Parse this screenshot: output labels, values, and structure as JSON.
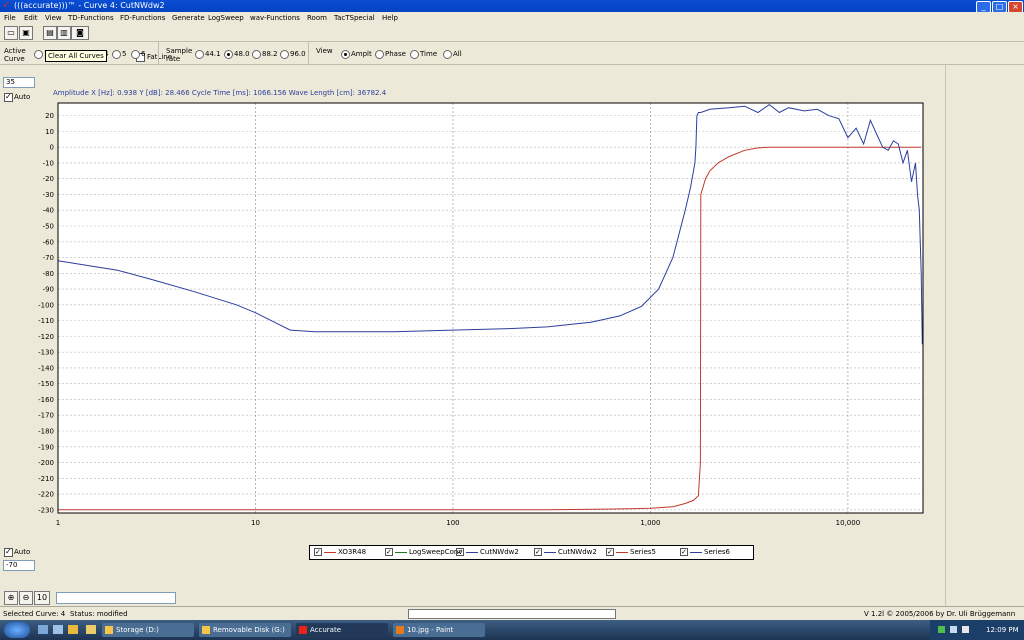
{
  "window": {
    "title": "(((accurate)))™ - Curve 4: CutNWdw2"
  },
  "menu": [
    "File",
    "Edit",
    "View",
    "TD-Functions",
    "FD-Functions",
    "Generate",
    "LogSweep",
    "wav-Functions",
    "Room",
    "TacTSpecial",
    "Help"
  ],
  "toolbar": {
    "fatline_label": "FatLine",
    "fatline_checked": false
  },
  "tooltip": {
    "text": "Clear All Curves"
  },
  "active_curve": {
    "label_line1": "Active",
    "label_line2": "Curve",
    "options": [
      "1",
      "4",
      "5",
      "6"
    ]
  },
  "sample_rate": {
    "label_line1": "Sample",
    "label_line2": "rate",
    "options": [
      "44.1",
      "48.0",
      "88.2",
      "96.0"
    ],
    "selected": "48.0"
  },
  "view": {
    "label": "View",
    "options": [
      "Amplt",
      "Phase",
      "Time",
      "All"
    ],
    "selected": "Amplt"
  },
  "y_axis": {
    "top_value": "35",
    "bottom_value": "-70",
    "auto_label": "Auto",
    "auto_checked": true
  },
  "info_line": "Amplitude   X [Hz]: 0.938   Y [dB]: 28.466   Cycle Time [ms]: 1066.156   Wave Length [cm]: 36782.4",
  "chart_data": {
    "type": "line",
    "xscale": "log",
    "xlim": [
      1,
      24000
    ],
    "ylim": [
      -232,
      28
    ],
    "y_ticks": [
      20,
      10,
      0,
      -10,
      -20,
      -30,
      -40,
      -50,
      -60,
      -70,
      -80,
      -90,
      -100,
      -110,
      -120,
      -130,
      -140,
      -150,
      -160,
      -170,
      -180,
      -190,
      -200,
      -210,
      -220,
      -230
    ],
    "x_tick_labels": [
      {
        "value": 1,
        "label": "1"
      },
      {
        "value": 10,
        "label": "10"
      },
      {
        "value": 100,
        "label": "100"
      },
      {
        "value": 1000,
        "label": "1,000"
      },
      {
        "value": 10000,
        "label": "10,000"
      }
    ],
    "grid": true,
    "series": [
      {
        "name": "XO3R48",
        "color": "#c0392b",
        "x": [
          1,
          100,
          300,
          600,
          1000,
          1300,
          1500,
          1650,
          1750,
          1790,
          1800,
          1850,
          1900,
          2000,
          2200,
          2500,
          3000,
          3500,
          4000,
          6000,
          10000,
          15000,
          20000,
          22000,
          23500
        ],
        "y": [
          -230,
          -230,
          -230,
          -229.5,
          -229,
          -228,
          -226,
          -224,
          -221,
          -200,
          -30,
          -25,
          -20,
          -15,
          -10,
          -6,
          -2,
          -0.5,
          0,
          0,
          0,
          0,
          0,
          0,
          0
        ]
      },
      {
        "name": "CutNWdw2",
        "color": "#2c3e9e",
        "x": [
          1,
          2,
          3,
          5,
          8,
          10,
          12,
          15,
          20,
          30,
          50,
          100,
          200,
          300,
          500,
          700,
          900,
          1100,
          1300,
          1500,
          1600,
          1680,
          1700,
          1720,
          1750,
          1800,
          2000,
          2500,
          3000,
          3500,
          4000,
          4500,
          5000,
          6000,
          7000,
          8000,
          9000,
          10000,
          11000,
          12000,
          13000,
          14000,
          15000,
          16000,
          17000,
          18000,
          19000,
          20000,
          21000,
          22000,
          22500,
          23000,
          23500,
          23800
        ],
        "y": [
          -72,
          -78,
          -84,
          -92,
          -100,
          -105,
          -110,
          -116,
          -117,
          -117,
          -117,
          -116,
          -115,
          -114,
          -111,
          -107,
          -101,
          -90,
          -70,
          -40,
          -25,
          -10,
          0,
          20,
          22,
          22,
          24,
          25,
          26,
          22,
          27,
          22,
          25,
          23,
          24,
          20,
          18,
          6,
          12,
          2,
          17,
          8,
          0,
          -2,
          4,
          2,
          -10,
          -2,
          -22,
          -10,
          -30,
          -40,
          -80,
          -125
        ]
      }
    ]
  },
  "legend": [
    "XO3R48",
    "LogSweepConv",
    "CutNWdw2",
    "CutNWdw2",
    "Series5",
    "Series6"
  ],
  "zoom": {
    "btn1": "+",
    "btn2": "-",
    "btn3": "10"
  },
  "status": {
    "selected": "Selected Curve: 4",
    "state": "Status: modified",
    "version": "V 1.2l © 2005/2006 by Dr. Uli Brüggemann"
  },
  "taskbar": {
    "items": [
      "Storage (D:)",
      "Removable Disk (G:)",
      "Accurate",
      "10.jpg - Paint"
    ],
    "active": "Accurate",
    "clock": "12:09 PM"
  }
}
